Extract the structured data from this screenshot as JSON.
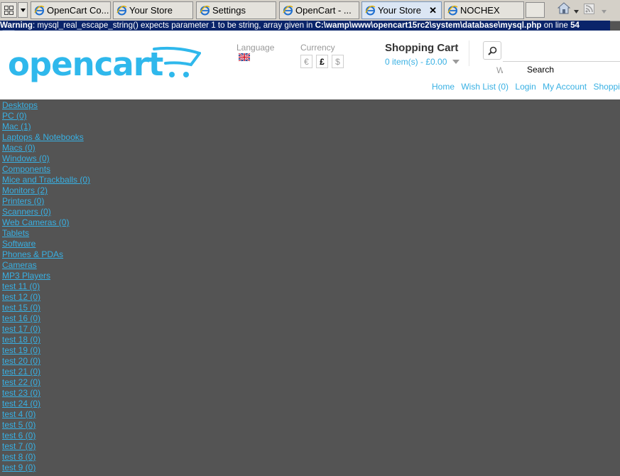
{
  "browser": {
    "tabs": [
      {
        "label": "OpenCart Co...",
        "active": false
      },
      {
        "label": "Your Store",
        "active": false
      },
      {
        "label": "Settings",
        "active": false
      },
      {
        "label": "OpenCart - ...",
        "active": false
      },
      {
        "label": "Your Store",
        "active": true
      },
      {
        "label": "NOCHEX",
        "active": false
      }
    ],
    "close_glyph": "✕",
    "icons": [
      "quick-tabs-icon",
      "tab-list-icon",
      "home-icon",
      "feeds-icon"
    ]
  },
  "warning": {
    "prefix": "Warning",
    "text": ": mysql_real_escape_string() expects parameter 1 to be string, array given in ",
    "path": "C:\\wamp\\www\\opencart15rc2\\system\\database\\mysql.php",
    "mid": " on line ",
    "line": "54"
  },
  "header": {
    "logo": "opencart",
    "language_label": "Language",
    "currency_label": "Currency",
    "currencies": [
      "€",
      "£",
      "$"
    ],
    "selected_currency": "£",
    "cart_title": "Shopping Cart",
    "cart_info": "0 item(s) - £0.00",
    "search_placeholder": "Search",
    "search_stub": "W",
    "links": [
      "Home",
      "Wish List (0)",
      "Login",
      "My Account",
      "Shoppin"
    ]
  },
  "categories": [
    "Desktops",
    "PC (0)",
    "Mac (1)",
    "Laptops & Notebooks",
    "Macs (0)",
    "Windows (0)",
    "Components",
    "Mice and Trackballs (0)",
    "Monitors (2)",
    "Printers (0)",
    "Scanners (0)",
    "Web Cameras (0)",
    "Tablets",
    "Software",
    "Phones & PDAs",
    "Cameras",
    "MP3 Players",
    "test 11 (0)",
    "test 12 (0)",
    "test 15 (0)",
    "test 16 (0)",
    "test 17 (0)",
    "test 18 (0)",
    "test 19 (0)",
    "test 20 (0)",
    "test 21 (0)",
    "test 22 (0)",
    "test 23 (0)",
    "test 24 (0)",
    "test 4 (0)",
    "test 5 (0)",
    "test 6 (0)",
    "test 7 (0)",
    "test 8 (0)",
    "test 9 (0)"
  ],
  "colors": {
    "link": "#38b0e3",
    "warning_bg": "#0a246a",
    "page_bg": "#545454"
  }
}
